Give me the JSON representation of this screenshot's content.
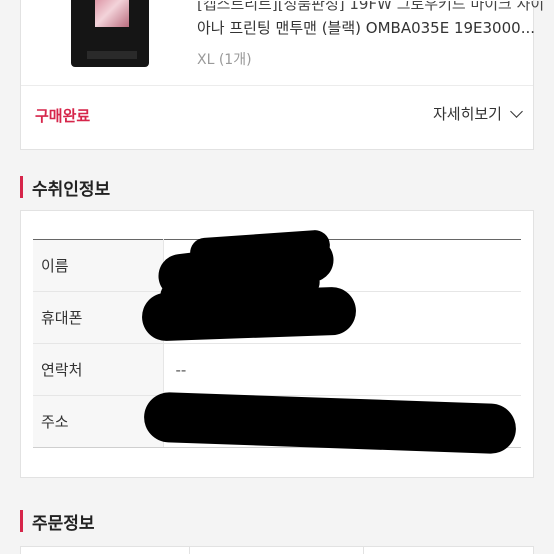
{
  "product": {
    "title_line1": "[캡스트리트][정품판정] 19FW 그로우키드 마이크 사이",
    "title_line2": "아나 프린팅 맨투맨 (블랙) OMBA035E 19E3000...",
    "option": "XL (1개)",
    "thumbnail_icon": "product-thumbnail-sweatshirt"
  },
  "order_status": {
    "status": "구매완료",
    "details_label": "자세히보기"
  },
  "recipient": {
    "section_title": "수취인정보",
    "rows": [
      {
        "label": "이름",
        "value": ""
      },
      {
        "label": "휴대폰",
        "value": ""
      },
      {
        "label": "연락처",
        "value": "--"
      },
      {
        "label": "주소",
        "value": ""
      }
    ]
  },
  "order_info": {
    "section_title": "주문정보"
  },
  "colors": {
    "accent": "#d6254a",
    "background": "#f4f4f4",
    "card": "#ffffff"
  }
}
